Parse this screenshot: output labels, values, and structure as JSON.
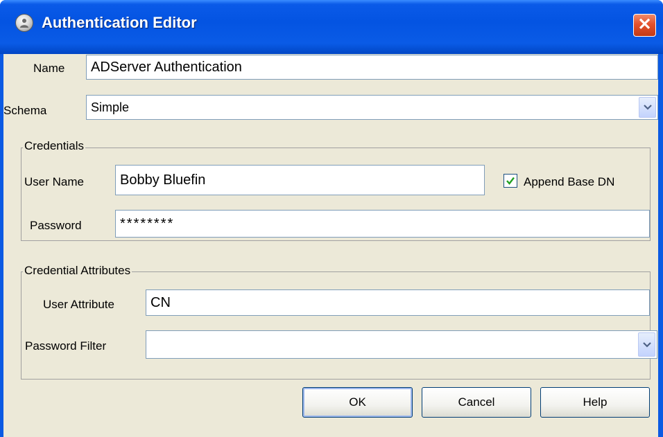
{
  "window": {
    "title": "Authentication Editor",
    "close_glyph": "✕",
    "icon": "user-globe-icon"
  },
  "form": {
    "name_label": "Name",
    "name_value": "ADServer Authentication",
    "schema_label": "Schema",
    "schema_value": "Simple"
  },
  "credentials": {
    "title": "Credentials",
    "user_name_label": "User Name",
    "user_name_value": "Bobby Bluefin",
    "append_base_dn_label": "Append Base DN",
    "append_base_dn_checked": true,
    "password_label": "Password",
    "password_value": "********"
  },
  "credential_attributes": {
    "title": "Credential Attributes",
    "user_attribute_label": "User Attribute",
    "user_attribute_value": "CN",
    "password_filter_label": "Password Filter",
    "password_filter_value": ""
  },
  "buttons": {
    "ok": "OK",
    "cancel": "Cancel",
    "help": "Help"
  },
  "colors": {
    "title_bar": "#0454e2",
    "client_background": "#ece9d8",
    "close_button": "#e4512d",
    "input_border": "#7f9db9"
  }
}
